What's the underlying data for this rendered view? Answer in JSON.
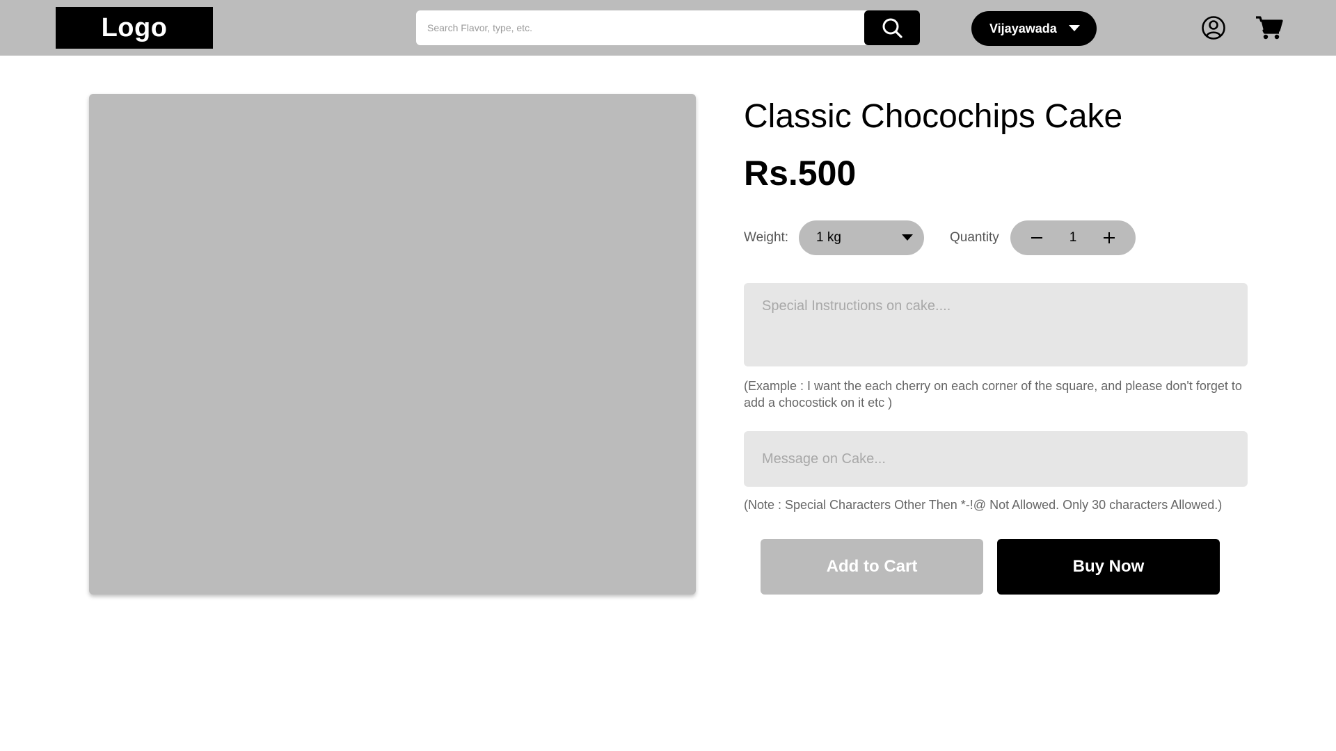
{
  "header": {
    "logo_text": "Logo",
    "search": {
      "placeholder": "Search Flavor, type, etc.",
      "value": "",
      "icon": "search-icon"
    },
    "city": {
      "selected": "Vijayawada",
      "icon": "chevron-down-icon"
    },
    "icons": {
      "account": "user-circle-icon",
      "cart": "shopping-cart-icon"
    },
    "background_color": "#bcbcbc"
  },
  "product": {
    "image_placeholder_color": "#bbbbbb",
    "title": "Classic Chocochips Cake",
    "price": "Rs.500",
    "weight": {
      "label": "Weight:",
      "selected": "1 kg"
    },
    "quantity": {
      "label": "Quantity",
      "value": "1",
      "minus_icon": "minus-icon",
      "plus_icon": "plus-icon"
    },
    "instructions": {
      "placeholder": "Special Instructions on cake....",
      "value": "",
      "note": "(Example : I want the each cherry on each corner of the square, and please don't forget to add a chocostick on it etc )"
    },
    "message": {
      "placeholder": "Message on Cake...",
      "value": "",
      "note": "(Note : Special Characters Other Then *-!@ Not Allowed. Only 30 characters Allowed.)"
    },
    "actions": {
      "add_to_cart": "Add to Cart",
      "buy_now": "Buy Now"
    }
  }
}
